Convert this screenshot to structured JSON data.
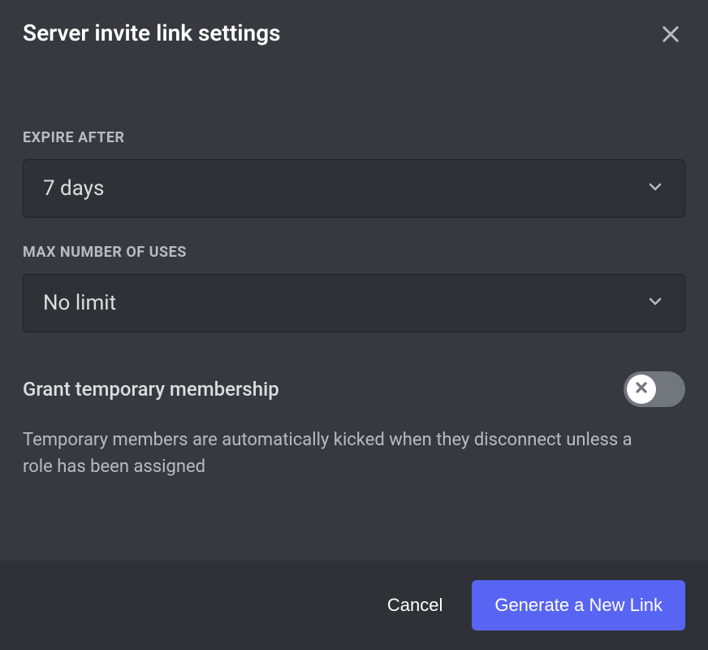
{
  "header": {
    "title": "Server invite link settings"
  },
  "fields": {
    "expire": {
      "label": "EXPIRE AFTER",
      "value": "7 days"
    },
    "maxUses": {
      "label": "MAX NUMBER OF USES",
      "value": "No limit"
    }
  },
  "toggle": {
    "label": "Grant temporary membership",
    "description": "Temporary members are automatically kicked when they disconnect unless a role has been assigned",
    "enabled": false
  },
  "footer": {
    "cancel": "Cancel",
    "generate": "Generate a New Link"
  }
}
